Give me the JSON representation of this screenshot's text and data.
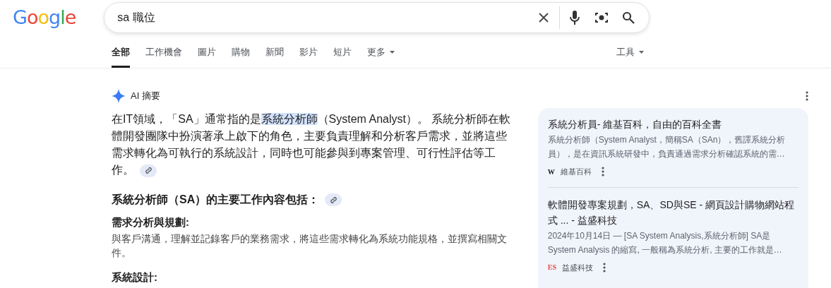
{
  "logo": [
    {
      "letter": "G",
      "color": "#4285f4"
    },
    {
      "letter": "o",
      "color": "#ea4335"
    },
    {
      "letter": "o",
      "color": "#fbbc05"
    },
    {
      "letter": "g",
      "color": "#4285f4"
    },
    {
      "letter": "l",
      "color": "#34a853"
    },
    {
      "letter": "e",
      "color": "#ea4335"
    }
  ],
  "search": {
    "value": "sa 職位"
  },
  "tabs": [
    {
      "label": "全部",
      "selected": true
    },
    {
      "label": "工作機會",
      "selected": false
    },
    {
      "label": "圖片",
      "selected": false
    },
    {
      "label": "購物",
      "selected": false
    },
    {
      "label": "新聞",
      "selected": false
    },
    {
      "label": "影片",
      "selected": false
    },
    {
      "label": "短片",
      "selected": false
    },
    {
      "label": "更多",
      "selected": false,
      "dropdown": true
    }
  ],
  "tools": {
    "label": "工具"
  },
  "ai_overview": {
    "title": "AI 摘要",
    "intro": {
      "before": "在IT領域，「SA」通常指的是",
      "highlight": "系統分析師",
      "after": "（System Analyst）。 系統分析師在軟體開發團隊中扮演著承上啟下的角色，主要負責理解和分析客戶需求，並將這些需求轉化為可執行的系統設計，同時也可能參與到專案管理、可行性評估等工作。"
    },
    "heading": "系統分析師（SA）的主要工作內容包括：",
    "items": [
      {
        "title": "需求分析與規劃:",
        "text": "與客戶溝通，理解並記錄客戶的業務需求，將這些需求轉化為系統功能規格，並撰寫相關文件。"
      },
      {
        "title": "系統設計:"
      }
    ],
    "sources": [
      {
        "title": "系統分析員- 維基百科，自由的百科全書",
        "snippet": "系統分析師（System Analyst，簡稱SA（SAn），舊譯系統分析員），是在資訊系統研發中，負責通過需求分析確認系統的需…",
        "favicon": {
          "text": "W",
          "color": "#222222"
        },
        "site": "維基百科"
      },
      {
        "title": "軟體開發專案規劃，SA、SD與SE - 網頁設計購物網站程式 ... - 益盛科技",
        "snippet": "2024年10月14日 — [SA System Analysis,系統分析師] SA是System Analysis 的縮寫, 一般稱為系統分析, 主要的工作就是…",
        "favicon": {
          "text": "ES",
          "color": "#e8453c"
        },
        "site": "益盛科技"
      }
    ]
  }
}
